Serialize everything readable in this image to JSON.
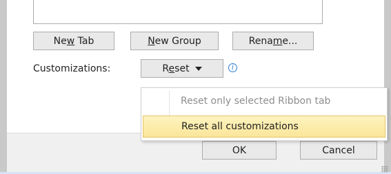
{
  "buttons": {
    "new_tab": {
      "pre": "Ne",
      "underlined": "w",
      "post": " Tab"
    },
    "new_group": {
      "pre": "",
      "underlined": "N",
      "post": "ew Group"
    },
    "rename": {
      "pre": "Rena",
      "underlined": "m",
      "post": "e..."
    }
  },
  "customizations": {
    "label": "Customizations:",
    "reset": {
      "pre": "R",
      "underlined": "e",
      "post": "set"
    }
  },
  "reset_menu": {
    "items": [
      {
        "label": "Reset only selected Ribbon tab",
        "enabled": false
      },
      {
        "label": "Reset all customizations",
        "enabled": true,
        "highlighted": true
      }
    ]
  },
  "footer": {
    "ok_label": "OK",
    "cancel_label": "Cancel"
  },
  "icons": {
    "reset_dropdown": "caret-down-icon",
    "info": "info-icon"
  },
  "colors": {
    "menu_highlight": "#fbe59a",
    "info_accent": "#2d7bd6"
  }
}
